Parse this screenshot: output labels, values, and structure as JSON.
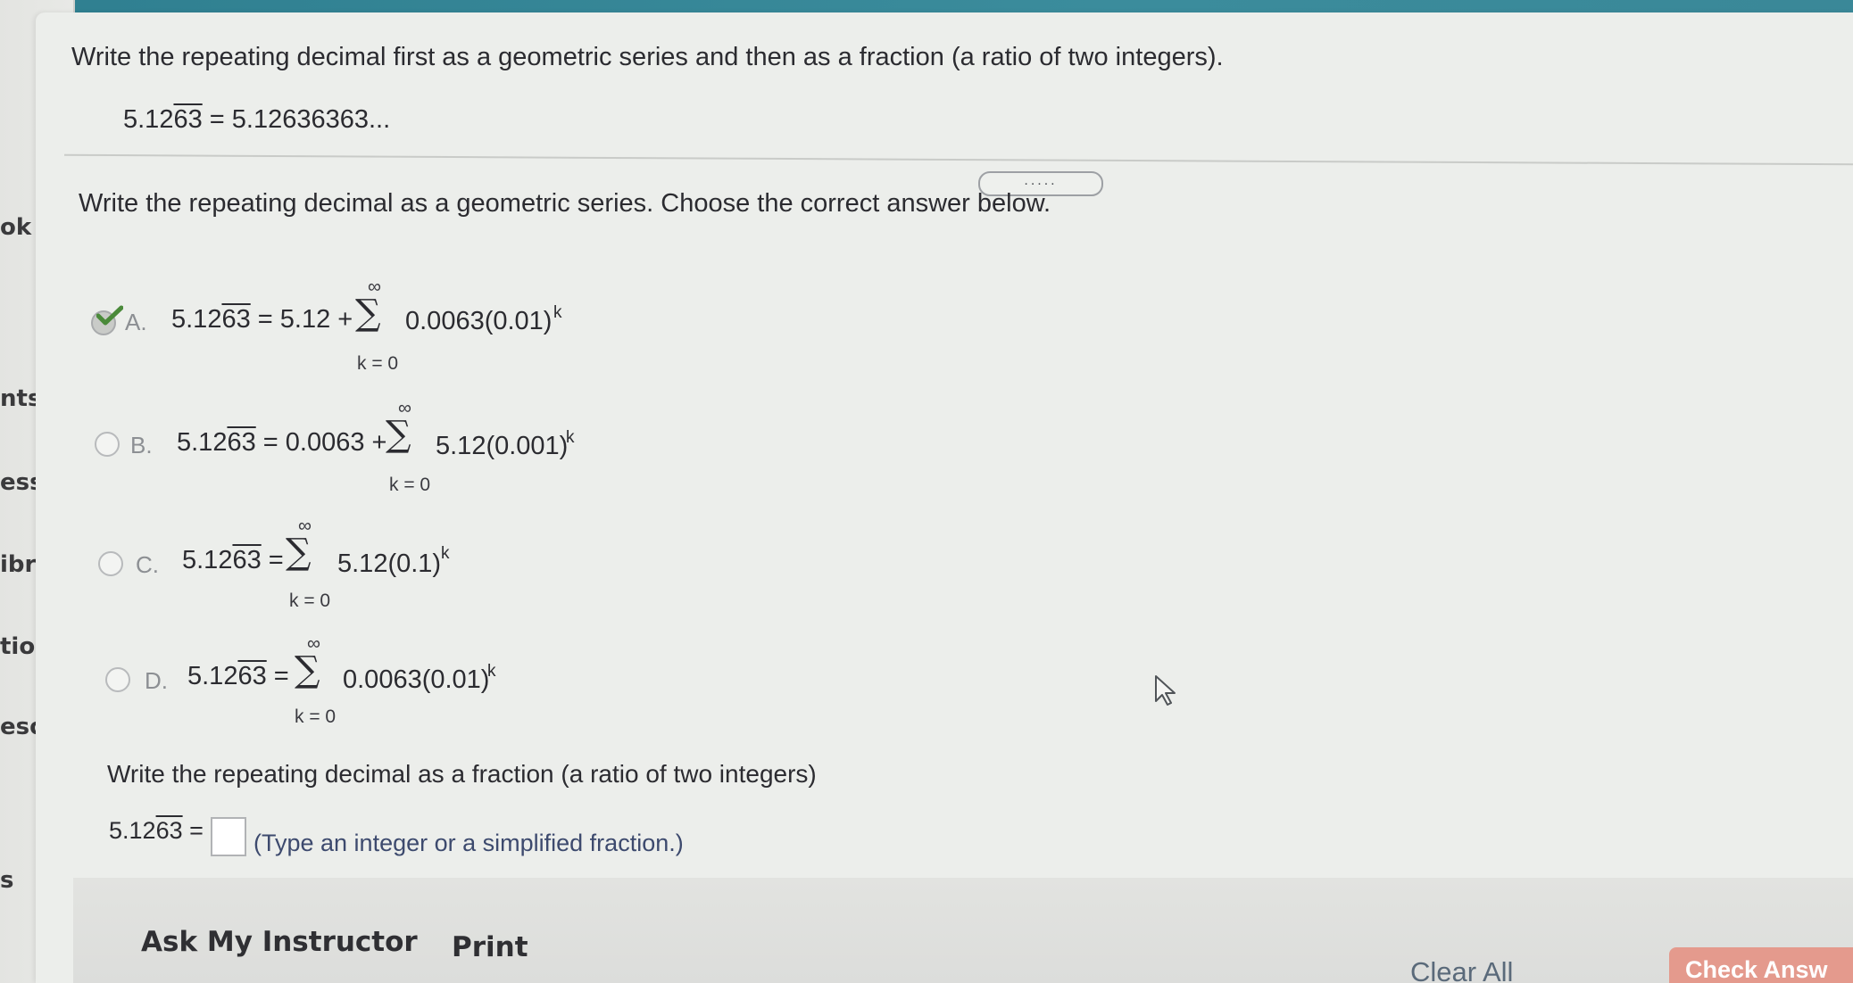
{
  "nav": {
    "items": [
      "ok",
      "nts",
      "ess",
      "ibrary",
      "tions",
      "esourc",
      "s"
    ]
  },
  "question": {
    "instruction": "Write the repeating decimal first as a geometric series and then as a fraction (a ratio of two integers).",
    "decimal_lhs_prefix": "5.12",
    "decimal_lhs_repeat": "63",
    "decimal_rhs": " = 5.12636363..."
  },
  "expand_label": ".....",
  "part1": {
    "prompt": "Write the repeating decimal as a geometric series. Choose the correct answer below.",
    "choices": [
      {
        "letter": "A.",
        "lhs_prefix": "5.12",
        "lhs_repeat": "63",
        "lead": " = 5.12 +",
        "term": "0.0063(0.01)",
        "selected": true
      },
      {
        "letter": "B.",
        "lhs_prefix": "5.12",
        "lhs_repeat": "63",
        "lead": " = 0.0063 +",
        "term": "5.12(0.001)",
        "selected": false
      },
      {
        "letter": "C.",
        "lhs_prefix": "5.12",
        "lhs_repeat": "63",
        "lead": " =",
        "term": "5.12(0.1)",
        "selected": false
      },
      {
        "letter": "D.",
        "lhs_prefix": "5.12",
        "lhs_repeat": "63",
        "lead": " =",
        "term": "0.0063(0.01)",
        "selected": false
      }
    ],
    "sum_upper": "∞",
    "sum_lower": "k = 0",
    "exponent": "k",
    "sigma": "∑"
  },
  "part2": {
    "prompt": "Write the repeating decimal as a fraction (a ratio of two integers)",
    "lhs_prefix": "5.12",
    "lhs_repeat": "63",
    "eq": " =",
    "hint": "(Type an integer or a simplified fraction.)"
  },
  "actions": {
    "ask_instructor": "Ask My Instructor",
    "print": "Print",
    "clear_all": "Clear All",
    "check_answer": "Check Answ"
  },
  "colors": {
    "header": "#3b8c9c",
    "check_button": "#e49a8d",
    "checkmark": "#4a8a3a"
  }
}
